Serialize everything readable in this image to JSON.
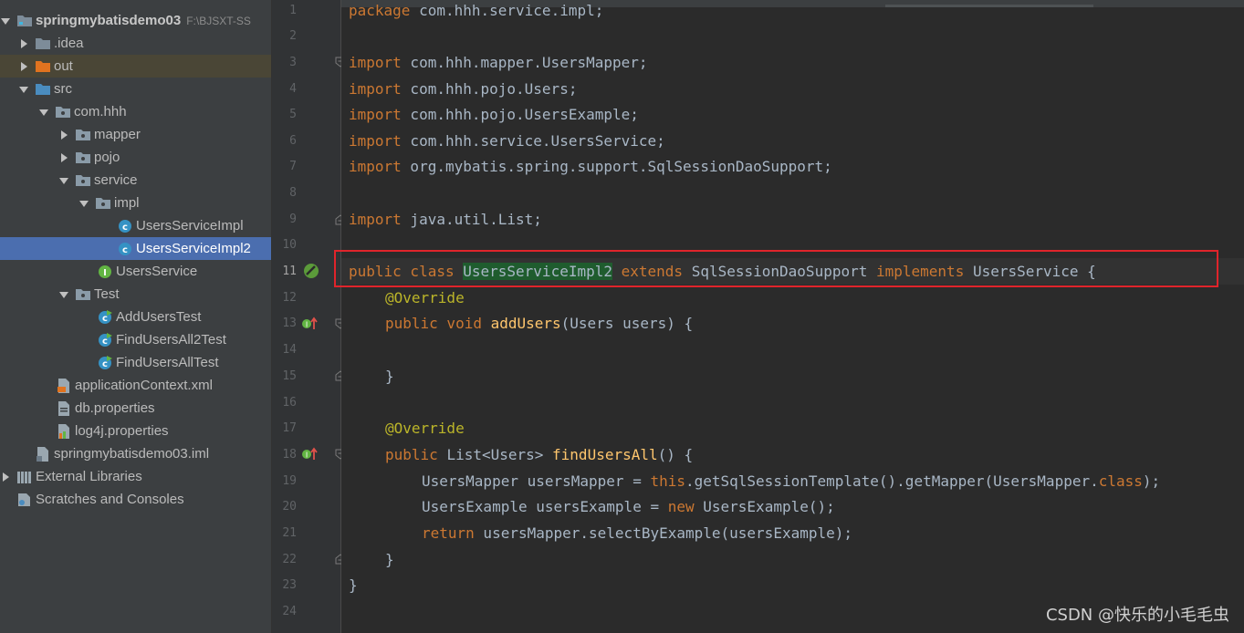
{
  "project_tree": {
    "root": {
      "name": "springmybatisdemo03",
      "path_hint": "F:\\BJSXT-SS"
    },
    "items": [
      {
        "label": ".idea"
      },
      {
        "label": "out"
      },
      {
        "label": "src"
      },
      {
        "label": "com.hhh"
      },
      {
        "label": "mapper"
      },
      {
        "label": "pojo"
      },
      {
        "label": "service"
      },
      {
        "label": "impl"
      },
      {
        "label": "UsersServiceImpl"
      },
      {
        "label": "UsersServiceImpl2"
      },
      {
        "label": "UsersService"
      },
      {
        "label": "Test"
      },
      {
        "label": "AddUsersTest"
      },
      {
        "label": "FindUsersAll2Test"
      },
      {
        "label": "FindUsersAllTest"
      },
      {
        "label": "applicationContext.xml"
      },
      {
        "label": "db.properties"
      },
      {
        "label": "log4j.properties"
      },
      {
        "label": "springmybatisdemo03.iml"
      },
      {
        "label": "External Libraries"
      },
      {
        "label": "Scratches and Consoles"
      }
    ]
  },
  "editor": {
    "line_numbers": [
      "1",
      "2",
      "3",
      "4",
      "5",
      "6",
      "7",
      "8",
      "9",
      "10",
      "11",
      "12",
      "13",
      "14",
      "15",
      "16",
      "17",
      "18",
      "19",
      "20",
      "21",
      "22",
      "23",
      "24"
    ],
    "code": {
      "l1_kw": "package",
      "l1_rest": " com.hhh.service.impl;",
      "import_kw": "import",
      "l3": " com.hhh.mapper.UsersMapper;",
      "l4": " com.hhh.pojo.Users;",
      "l5": " com.hhh.pojo.UsersExample;",
      "l6": " com.hhh.service.UsersService;",
      "l7": " org.mybatis.spring.support.SqlSessionDaoSupport;",
      "l9": " java.util.List;",
      "l11_public_class": "public class ",
      "l11_classname": "UsersServiceImpl2",
      "l11_extends": " extends ",
      "l11_parent": "SqlSessionDaoSupport",
      "l11_implements": " implements ",
      "l11_iface": "UsersService {",
      "override": "@Override",
      "l13_kw": "public void ",
      "l13_fn": "addUsers",
      "l13_rest": "(Users users) {",
      "close_brace": "}",
      "l18_kw": "public ",
      "l18_type": "List<Users> ",
      "l18_fn": "findUsersAll",
      "l18_rest": "() {",
      "l19_a": "UsersMapper usersMapper = ",
      "l19_this": "this",
      "l19_b": ".getSqlSessionTemplate().getMapper(UsersMapper.",
      "l19_class": "class",
      "l19_c": ");",
      "l20_a": "UsersExample usersExample = ",
      "l20_new": "new",
      "l20_b": " UsersExample();",
      "l21_kw": "return",
      "l21_rest": " usersMapper.selectByExample(usersExample);"
    }
  },
  "watermark": "CSDN @快乐的小毛毛虫"
}
